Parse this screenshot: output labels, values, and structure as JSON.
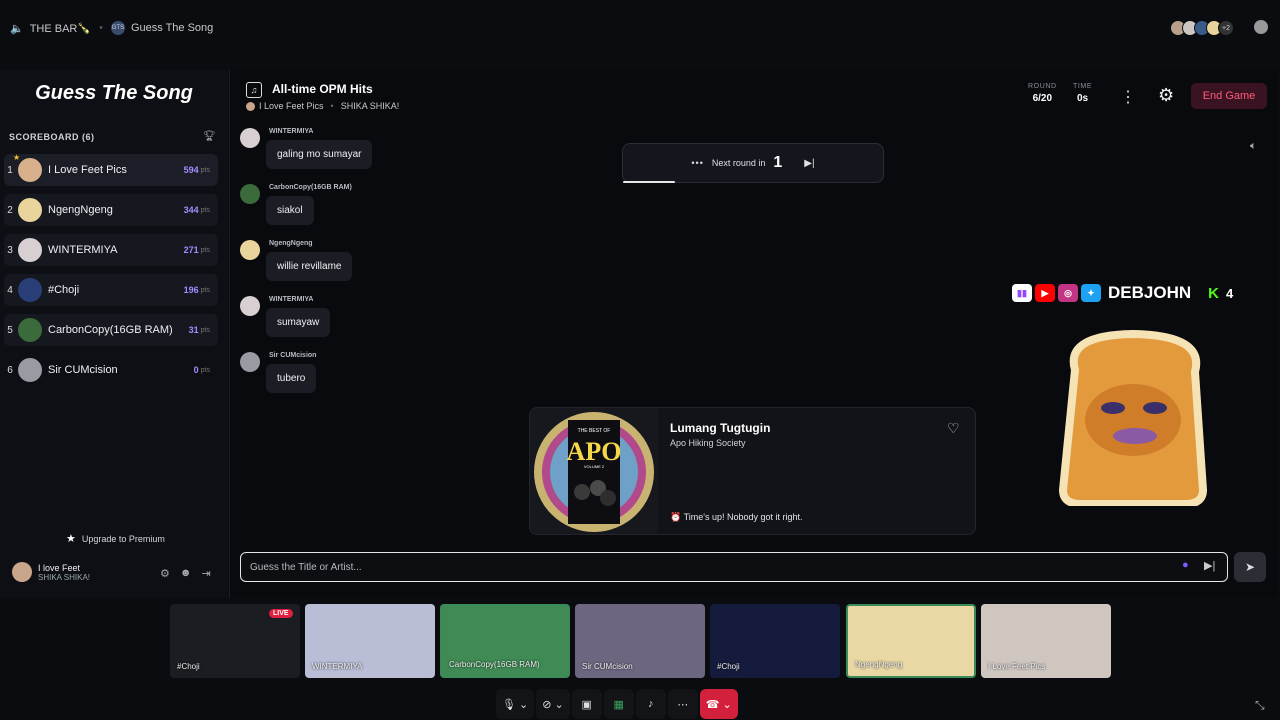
{
  "topbar": {
    "server_name": "THE BAR🍾",
    "server_icon": "speaker-icon",
    "activity_badge": "GTS",
    "activity_name": "Guess The Song",
    "participant_more": "+2"
  },
  "sidebar": {
    "title": "Guess The Song",
    "scoreboard_label": "SCOREBOARD (6)",
    "pts_label": "pts",
    "players": [
      {
        "rank": "1",
        "name": "I Love Feet Pics",
        "points": "594",
        "color": "#d9b08c"
      },
      {
        "rank": "2",
        "name": "NgengNgeng",
        "points": "344",
        "color": "#e9d59c"
      },
      {
        "rank": "3",
        "name": "WINTERMIYA",
        "points": "271",
        "color": "#d8cfd2"
      },
      {
        "rank": "4",
        "name": "#Choji",
        "points": "196",
        "color": "#2a3f78"
      },
      {
        "rank": "5",
        "name": "CarbonCopy(16GB RAM)",
        "points": "31",
        "color": "#3b6b3a"
      },
      {
        "rank": "6",
        "name": "Sir CUMcision",
        "points": "0",
        "color": "#9a9aa3"
      }
    ],
    "upgrade_label": "Upgrade to Premium",
    "current_user": {
      "name": "I love Feet",
      "status": "SHIKA SHIKA!"
    }
  },
  "game": {
    "playlist_title": "All-time OPM Hits",
    "host_name": "I Love Feet Pics",
    "host_status": "SHIKA SHIKA!",
    "round_label": "ROUND",
    "round_value": "6/20",
    "time_label": "TIME",
    "time_value": "0s",
    "end_game_label": "End Game",
    "next_round_label": "Next round in",
    "next_round_count": "1",
    "next_round_progress": 0.2
  },
  "chat": [
    {
      "author": "WINTERMIYA",
      "text": "galing mo sumayar",
      "color": "#d8cfd2"
    },
    {
      "author": "CarbonCopy(16GB RAM)",
      "text": "siakol",
      "color": "#3b6b3a"
    },
    {
      "author": "NgengNgeng",
      "text": "willie revillame",
      "color": "#e9d59c"
    },
    {
      "author": "WINTERMIYA",
      "text": "sumayaw",
      "color": "#d8cfd2"
    },
    {
      "author": "Sir CUMcision",
      "text": "tubero",
      "color": "#9a9aa3"
    }
  ],
  "streamer_overlay": {
    "name": "DEBJOHN",
    "kick_count": "4",
    "socials": [
      "twitch-icon",
      "youtube-icon",
      "instagram-icon",
      "twitter-icon"
    ]
  },
  "song_card": {
    "title": "Lumang Tugtugin",
    "artist": "Apo Hiking Society",
    "result": "Time's up! Nobody got it right.",
    "album_text": "APO",
    "album_sub": "THE BEST OF",
    "album_vol": "VOLUME 2"
  },
  "guess_input": {
    "placeholder": "Guess the Title or Artist...",
    "value": ""
  },
  "video_strip": [
    {
      "label": "#Choji",
      "live": "LIVE",
      "color": "#1b1d22"
    },
    {
      "label": "WINTERMIYA",
      "color": "#b9bdd6"
    },
    {
      "label": "CarbonCopy(16GB RAM)",
      "color": "#3f8a55"
    },
    {
      "label": "Sir CUMcision",
      "color": "#6d6680"
    },
    {
      "label": "#Choji",
      "color": "#151b3d"
    },
    {
      "label": "NgengNgeng",
      "color": "#e9d8a4"
    },
    {
      "label": "I Love Feet Pics",
      "color": "#cfc6c0"
    }
  ]
}
